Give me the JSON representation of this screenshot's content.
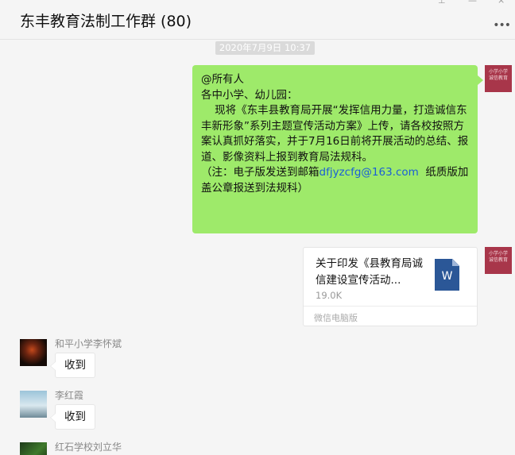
{
  "header": {
    "title": "东丰教育法制工作群 (80)",
    "more_glyph": "•••"
  },
  "timestamp": "2020年7月9日  10:37",
  "messages": {
    "announcement": {
      "line1": "@所有人",
      "line2": "各中小学、幼儿园：",
      "body": "    现将《东丰县教育局开展“发挥信用力量，打造诚信东丰新形象”系列主题宣传活动方案》上传，请各校按照方案认真抓好落实，并于7月16日前将开展活动的总结、报道、影像资料上报到教育局法规科。",
      "note_prefix": "（注：电子版发送到邮箱",
      "note_email": "dfjyzcfg@163.com",
      "note_suffix": "  纸质版加盖公章报送到法规科）"
    },
    "file": {
      "name": "关于印发《县教育局诚信建设宣传活动...",
      "size": "19.0K",
      "source": "微信电脑版",
      "icon_letter": "W"
    },
    "replies": [
      {
        "sender": "和平小学李怀斌",
        "text": "收到"
      },
      {
        "sender": "李红霞",
        "text": "收到"
      },
      {
        "sender": "红石学校刘立华"
      }
    ]
  },
  "self_avatar_text": "小学小学\n诚信教育",
  "colors": {
    "own_bubble": "#9eea6a",
    "link": "#1a5fd6",
    "word_icon": "#2b5797",
    "self_avatar": "#a8364a"
  }
}
